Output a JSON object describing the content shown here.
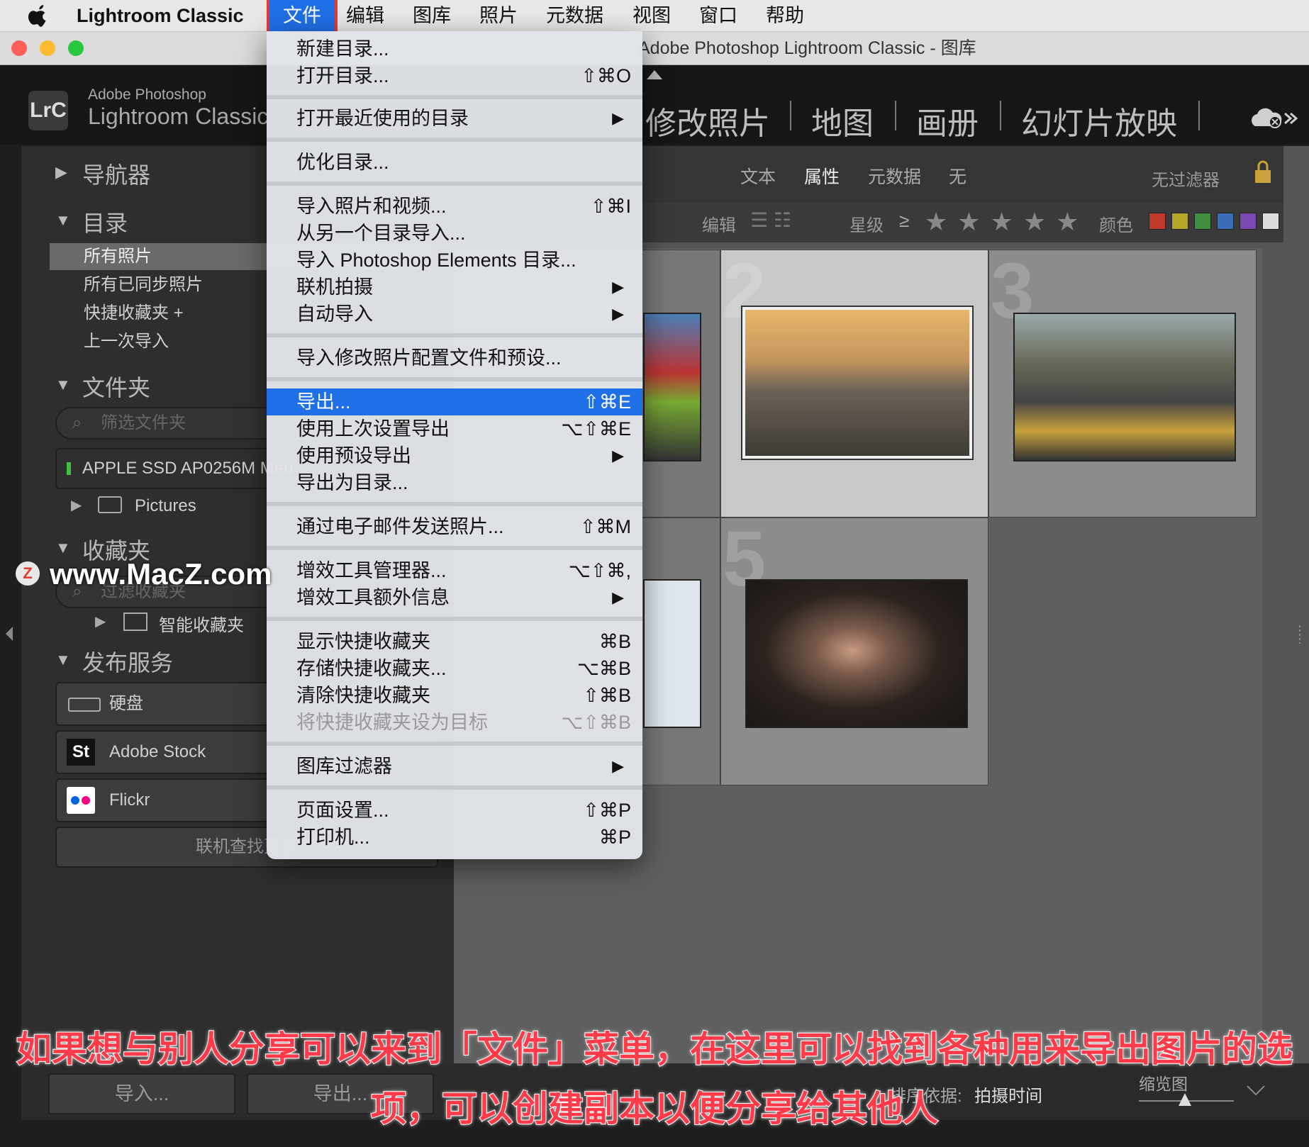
{
  "menubar": {
    "app_name": "Lightroom Classic",
    "items": [
      "文件",
      "编辑",
      "图库",
      "照片",
      "元数据",
      "视图",
      "窗口",
      "帮助"
    ]
  },
  "window": {
    "title": "Adobe Photoshop Lightroom Classic - 图库"
  },
  "identity": {
    "logo": "LrC",
    "small": "Adobe Photoshop",
    "big": "Lightroom Classic"
  },
  "modules": [
    "修改照片",
    "地图",
    "画册",
    "幻灯片放映"
  ],
  "left_panel": {
    "navigator": "导航器",
    "catalog": "目录",
    "catalog_items": [
      "所有照片",
      "所有已同步照片",
      "快捷收藏夹 +",
      "上一次导入"
    ],
    "folders": "文件夹",
    "folder_filter": "筛选文件夹",
    "drive": "APPLE SSD AP0256M Med",
    "pictures": "Pictures",
    "collections": "收藏夹",
    "collection_filter": "过滤收藏夹",
    "smart_collections": "智能收藏夹",
    "publish": "发布服务",
    "hard_drive": "硬盘",
    "adobe_stock": "Adobe Stock",
    "flickr": "Flickr",
    "find_more": "联机查找更多"
  },
  "filter_bar": {
    "text": "文本",
    "attribute": "属性",
    "metadata": "元数据",
    "none": "无",
    "preset": "无过滤器"
  },
  "attr_bar": {
    "edit": "编辑",
    "rating": "星级",
    "gte": "≥",
    "stars": "★ ★ ★ ★ ★",
    "color": "颜色"
  },
  "colors": {
    "red": "#c0392b",
    "yellow": "#b8a62a",
    "green": "#3f8e3f",
    "blue": "#3b6db5",
    "purple": "#7b4ab0",
    "menu_highlight": "#1f6fe6"
  },
  "grid": {
    "cells": [
      "2",
      "3",
      "5"
    ]
  },
  "bottom": {
    "import": "导入...",
    "export": "导出...",
    "sort_label": "排序依据:",
    "sort_value": "拍摄时间",
    "thumbnail": "缩览图"
  },
  "file_menu": {
    "new_catalog": "新建目录...",
    "open_catalog": "打开目录...",
    "open_catalog_sc": "⇧⌘O",
    "open_recent": "打开最近使用的目录",
    "optimize": "优化目录...",
    "import_photos": "导入照片和视频...",
    "import_photos_sc": "⇧⌘I",
    "import_catalog": "从另一个目录导入...",
    "import_pse": "导入 Photoshop Elements 目录...",
    "tethered": "联机拍摄",
    "auto_import": "自动导入",
    "import_profiles": "导入修改照片配置文件和预设...",
    "export": "导出...",
    "export_sc": "⇧⌘E",
    "export_previous": "使用上次设置导出",
    "export_previous_sc": "⌥⇧⌘E",
    "export_preset": "使用预设导出",
    "export_catalog": "导出为目录...",
    "email": "通过电子邮件发送照片...",
    "email_sc": "⇧⌘M",
    "plugin_manager": "增效工具管理器...",
    "plugin_manager_sc": "⌥⇧⌘,",
    "plugin_extras": "增效工具额外信息",
    "show_quick": "显示快捷收藏夹",
    "show_quick_sc": "⌘B",
    "save_quick": "存储快捷收藏夹...",
    "save_quick_sc": "⌥⌘B",
    "clear_quick": "清除快捷收藏夹",
    "clear_quick_sc": "⇧⌘B",
    "set_quick_target": "将快捷收藏夹设为目标",
    "set_quick_target_sc": "⌥⇧⌘B",
    "library_filters": "图库过滤器",
    "page_setup": "页面设置...",
    "page_setup_sc": "⇧⌘P",
    "printer": "打印机...",
    "printer_sc": "⌘P",
    "submenu_arrow": "▶"
  },
  "watermark": {
    "logo": "Z",
    "text": "www.MacZ.com"
  },
  "subtitle": {
    "line1": "如果想与别人分享可以来到「文件」菜单，在这里可以找到各种用来导出图片的选",
    "line2": "项，可以创建副本以便分享给其他人"
  }
}
